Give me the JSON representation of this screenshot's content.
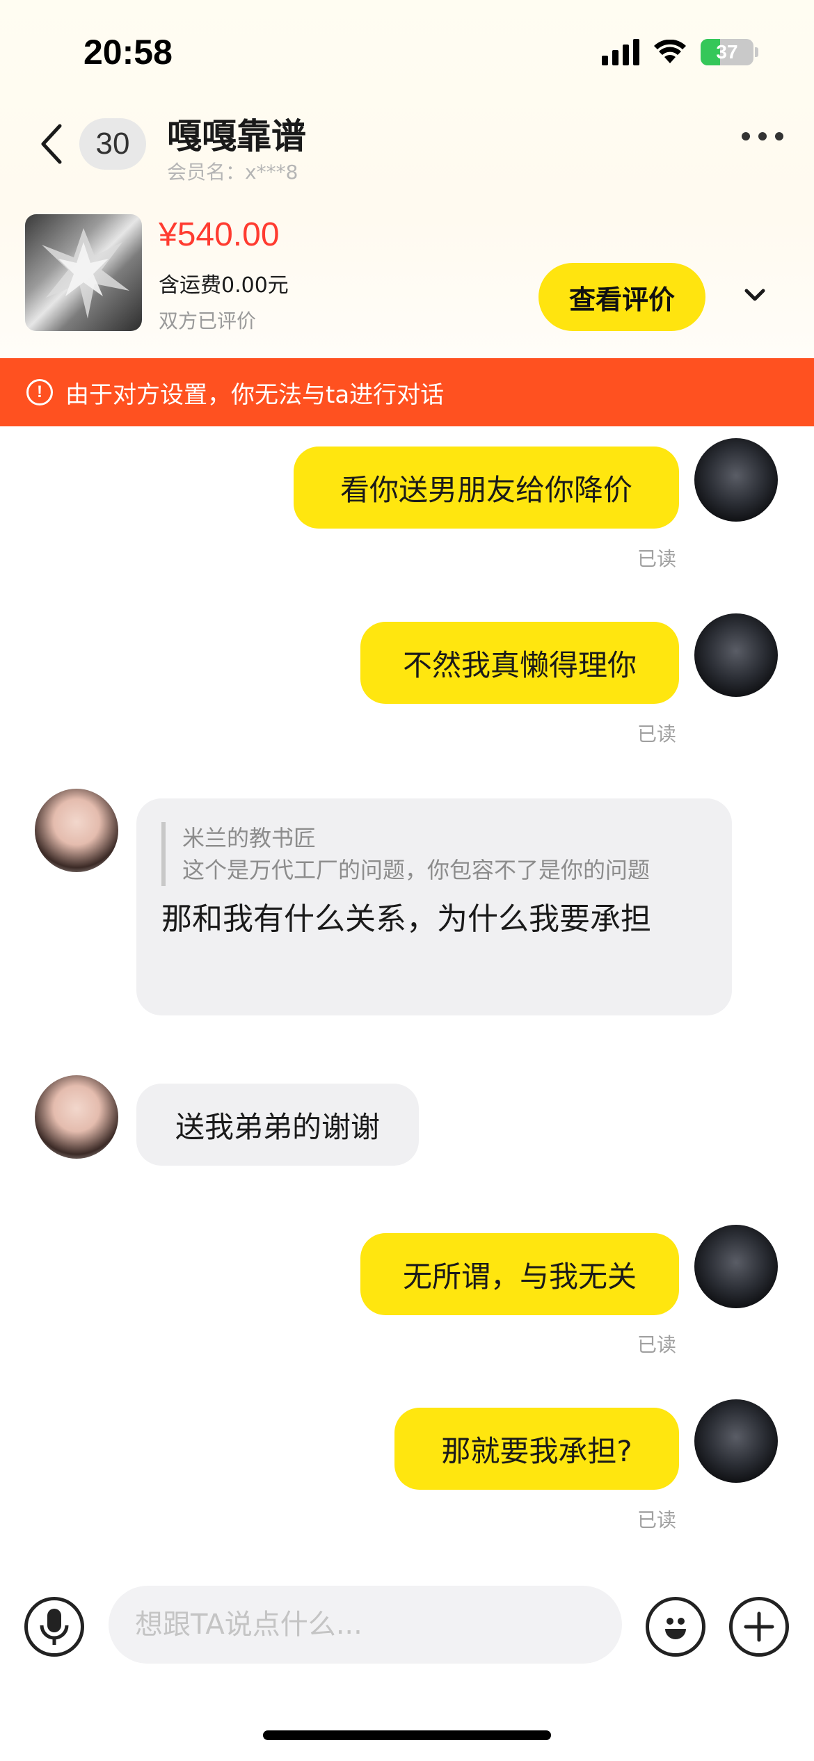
{
  "status_bar": {
    "time": "20:58",
    "battery": "37"
  },
  "header": {
    "unread_count": "30",
    "contact_name": "嘎嘎靠谱",
    "member_name": "会员名：x***8"
  },
  "product": {
    "price": "¥540.00",
    "shipping": "含运费0.00元",
    "rating_status": "双方已评价",
    "review_button": "查看评价"
  },
  "warning": {
    "text": "由于对方设置，你无法与ta进行对话"
  },
  "messages": [
    {
      "side": "me",
      "text": "看你送男朋友给你降价",
      "status": "已读"
    },
    {
      "side": "me",
      "text": "不然我真懒得理你",
      "status": "已读"
    },
    {
      "side": "them",
      "quote_author": "米兰的教书匠",
      "quote_text": "这个是万代工厂的问题，你包容不了是你的问题",
      "text": "那和我有什么关系，为什么我要承担"
    },
    {
      "side": "them",
      "text": "送我弟弟的谢谢"
    },
    {
      "side": "me",
      "text": "无所谓，与我无关",
      "status": "已读"
    },
    {
      "side": "me",
      "text": "那就要我承担?",
      "status": "已读"
    }
  ],
  "input": {
    "placeholder": "想跟TA说点什么..."
  },
  "colors": {
    "accent_yellow": "#ffe60f",
    "warning_orange": "#ff5120",
    "price_red": "#ff3b30"
  }
}
